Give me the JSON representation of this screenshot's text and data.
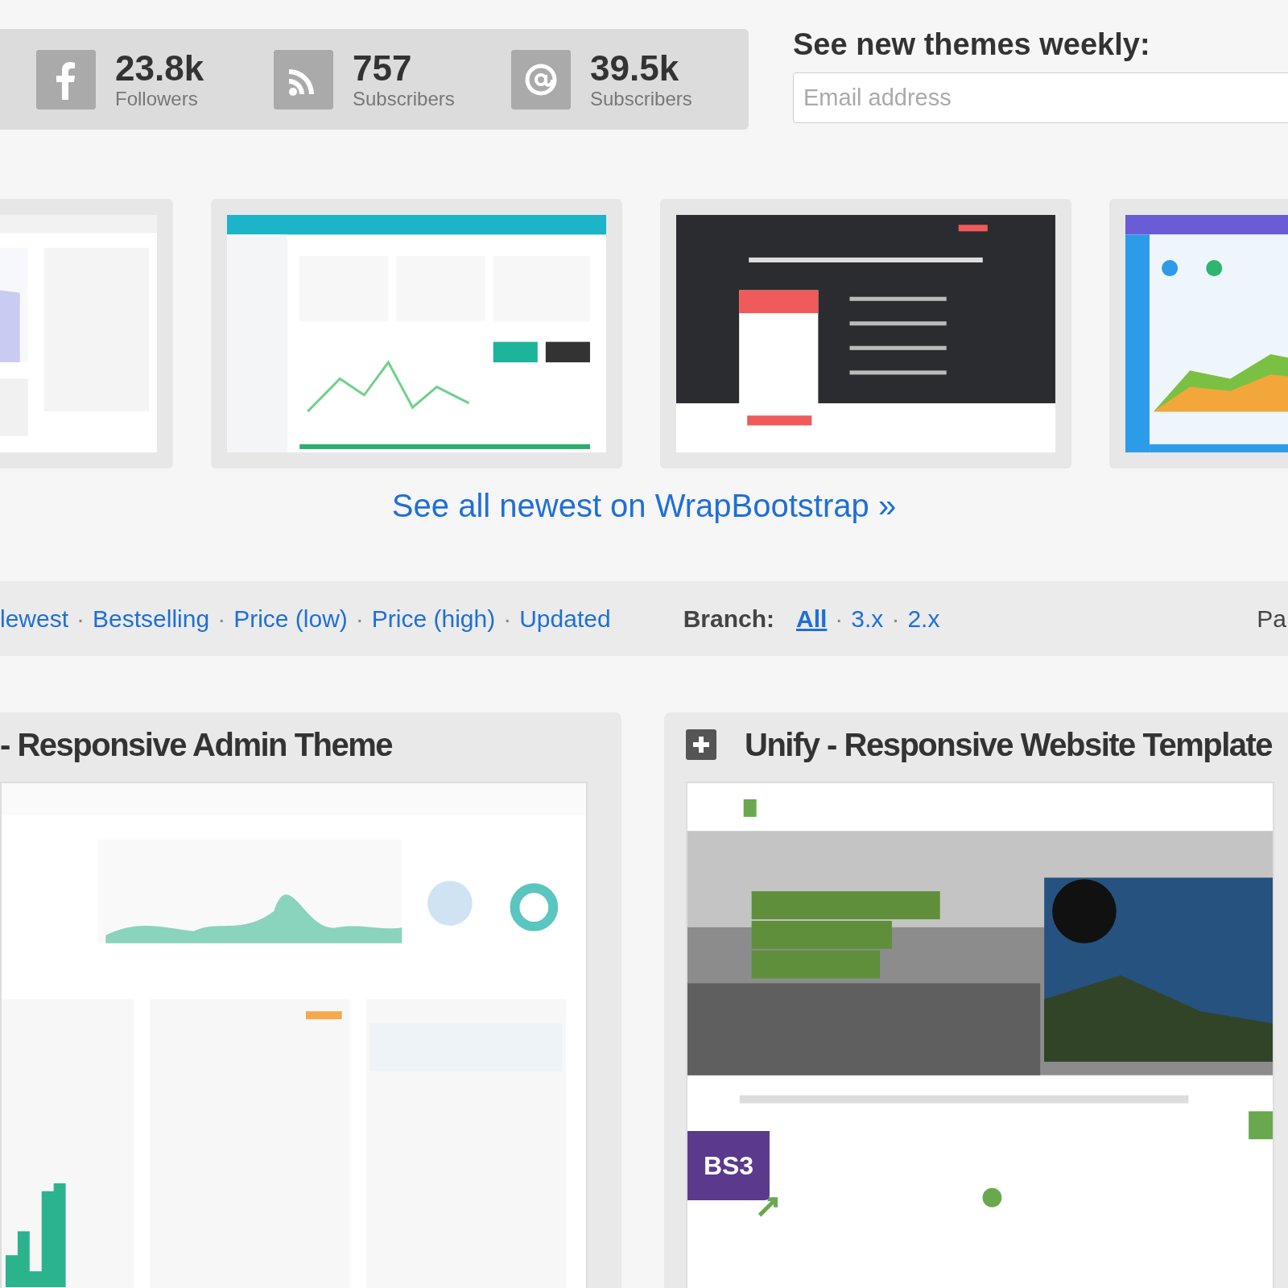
{
  "stats": [
    {
      "kind": "facebook",
      "count": "23.8k",
      "label": "Followers"
    },
    {
      "kind": "rss",
      "count": "757",
      "label": "Subscribers"
    },
    {
      "kind": "email",
      "count": "39.5k",
      "label": "Subscribers"
    }
  ],
  "newsletter": {
    "heading": "See new themes weekly:",
    "placeholder": "Email address"
  },
  "see_all_link": "See all newest on WrapBootstrap »",
  "sort_bar": {
    "separator": "·",
    "sort_options": [
      "lewest",
      "Bestselling",
      "Price (low)",
      "Price (high)",
      "Updated"
    ],
    "branch_label": "Branch:",
    "branch_options": [
      {
        "label": "All",
        "selected": true
      },
      {
        "label": "3.x",
        "selected": false
      },
      {
        "label": "2.x",
        "selected": false
      }
    ],
    "cut_label": "Pa"
  },
  "themes": [
    {
      "title": "- Responsive Admin Theme",
      "has_icon": false
    },
    {
      "title": "Unify - Responsive Website Template",
      "has_icon": true,
      "badge": "BS3"
    }
  ]
}
